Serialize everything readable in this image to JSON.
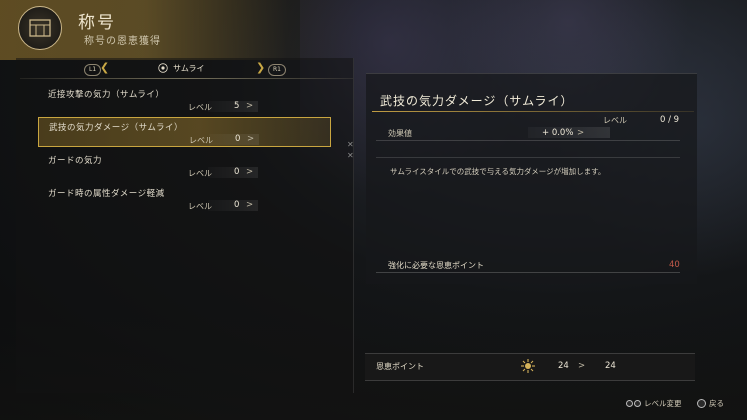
{
  "header": {
    "title": "称号",
    "subtitle": "称号の恩恵獲得"
  },
  "tabs": {
    "left_button": "L1",
    "right_button": "R1",
    "current": "サムライ"
  },
  "skills": [
    {
      "name": "近接攻撃の気力（サムライ）",
      "level_label": "レベル",
      "level": "5",
      "arrow": ">"
    },
    {
      "name": "武技の気力ダメージ（サムライ）",
      "level_label": "レベル",
      "level": "0",
      "arrow": ">"
    },
    {
      "name": "ガードの気力",
      "level_label": "レベル",
      "level": "0",
      "arrow": ">"
    },
    {
      "name": "ガード時の属性ダメージ軽減",
      "level_label": "レベル",
      "level": "0",
      "arrow": ">"
    }
  ],
  "detail": {
    "title": "武技の気力ダメージ（サムライ）",
    "level_label": "レベル",
    "level_value": "0 / 9",
    "effect_label": "効果値",
    "effect_value": "+ 0.0%",
    "effect_arrow": ">",
    "description": "サムライスタイルでの武技で与える気力ダメージが増加します。",
    "cost_label": "強化に必要な恩恵ポイント",
    "cost_value": "40"
  },
  "points": {
    "label": "恩恵ポイント",
    "current": "24",
    "arrow": ">",
    "after": "24"
  },
  "hints": {
    "level_change": "レベル変更",
    "back": "戻る"
  },
  "colors": {
    "accent_gold": "#c9a640",
    "cost_red": "#c45a4a"
  },
  "icons": {
    "emblem": "title-emblem-icon",
    "tab": "samurai-crest-icon",
    "points": "blessing-points-icon"
  }
}
